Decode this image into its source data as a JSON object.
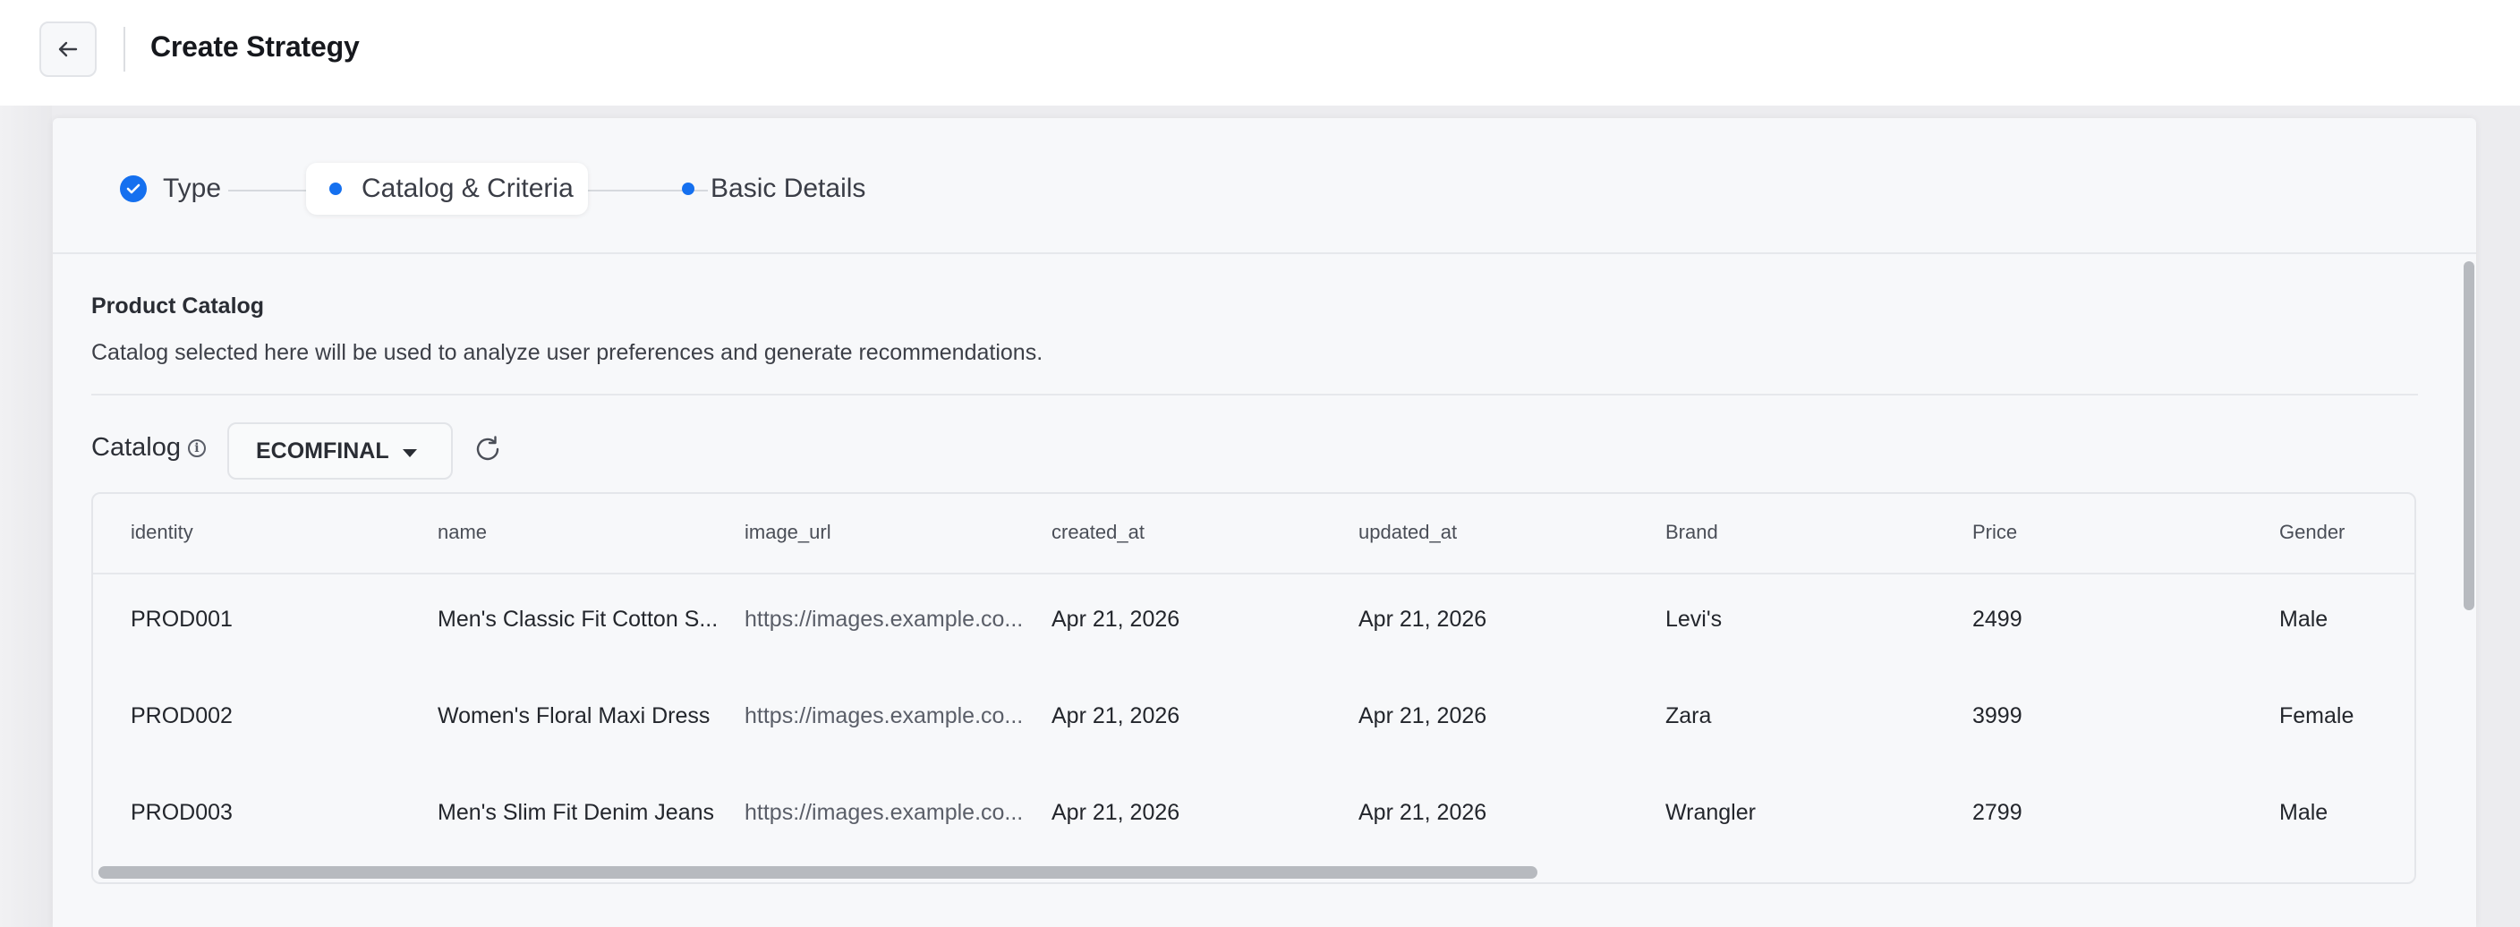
{
  "header": {
    "back_icon": "arrow-left-icon",
    "title": "Create Strategy"
  },
  "stepper": {
    "steps": [
      {
        "label": "Type",
        "state": "complete"
      },
      {
        "label": "Catalog & Criteria",
        "state": "active"
      },
      {
        "label": "Basic Details",
        "state": "pending"
      }
    ]
  },
  "section": {
    "title": "Product Catalog",
    "description": "Catalog selected here will be used to analyze user preferences and generate recommendations."
  },
  "catalog": {
    "label": "Catalog",
    "selected": "ECOMFINAL",
    "info_icon": "info-icon",
    "refresh_icon": "refresh-icon"
  },
  "table": {
    "columns": [
      "identity",
      "name",
      "image_url",
      "created_at",
      "updated_at",
      "Brand",
      "Price",
      "Gender"
    ],
    "rows": [
      [
        "PROD001",
        "Men's Classic Fit Cotton S...",
        "https://images.example.co...",
        "Apr 21, 2026",
        "Apr 21, 2026",
        "Levi's",
        "2499",
        "Male"
      ],
      [
        "PROD002",
        "Women's Floral Maxi Dress",
        "https://images.example.co...",
        "Apr 21, 2026",
        "Apr 21, 2026",
        "Zara",
        "3999",
        "Female"
      ],
      [
        "PROD003",
        "Men's Slim Fit Denim Jeans",
        "https://images.example.co...",
        "Apr 21, 2026",
        "Apr 21, 2026",
        "Wrangler",
        "2799",
        "Male"
      ]
    ]
  },
  "colors": {
    "accent": "#1570ef",
    "background": "#f7f8fa"
  }
}
